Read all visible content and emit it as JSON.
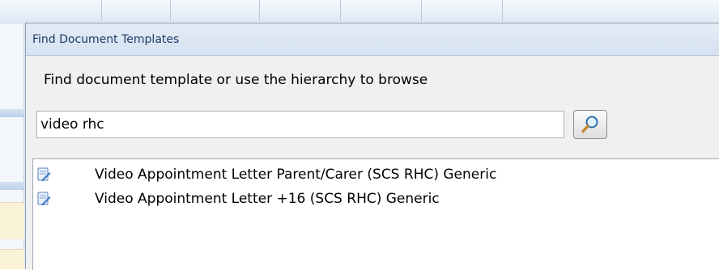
{
  "dialog": {
    "title": "Find Document Templates",
    "prompt": "Find document template or use the hierarchy to browse"
  },
  "search": {
    "value": "video rhc",
    "button_icon": "magnifier-icon"
  },
  "results": [
    {
      "label": "Video Appointment Letter Parent/Carer (SCS RHC) Generic",
      "icon": "document-template-icon"
    },
    {
      "label": "Video Appointment Letter +16 (SCS RHC) Generic",
      "icon": "document-template-icon"
    }
  ],
  "colors": {
    "title_text": "#1e3a66",
    "dialog_bg": "#f0f0f0",
    "title_bar": "#d6e2f1"
  }
}
